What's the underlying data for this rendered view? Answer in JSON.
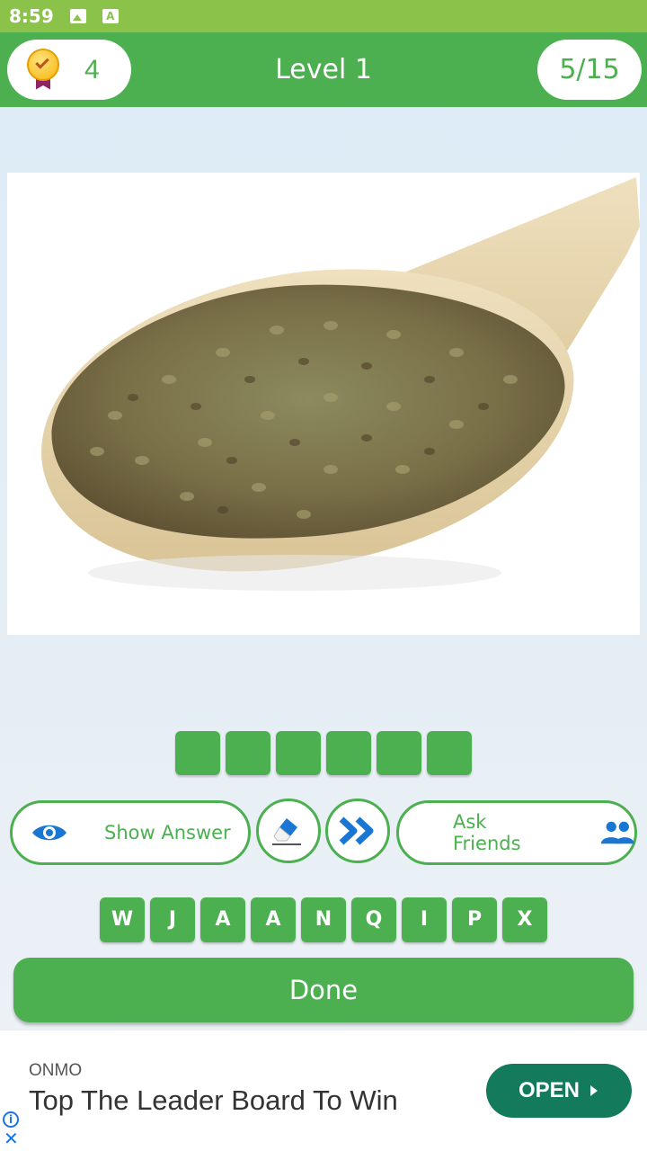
{
  "status_bar": {
    "time": "8:59",
    "icons": [
      "image-icon",
      "a-icon"
    ]
  },
  "header": {
    "coins": "4",
    "coin_icon": "medal-icon",
    "title": "Level 1",
    "progress": "5/15"
  },
  "puzzle": {
    "answer_length": 6,
    "slots": [
      "",
      "",
      "",
      "",
      "",
      ""
    ]
  },
  "help_buttons": {
    "show_answer_label": "Show Answer",
    "show_answer_icon": "eye-icon",
    "eraser_icon": "eraser-icon",
    "skip_icon": "double-chevron-icon",
    "ask_friends_label": "Ask Friends",
    "ask_friends_icon": "people-icon"
  },
  "letters": [
    "W",
    "J",
    "A",
    "A",
    "N",
    "Q",
    "I",
    "P",
    "X"
  ],
  "done_label": "Done",
  "ad": {
    "brand": "ONMO",
    "headline": "Top The Leader Board To Win",
    "cta": "OPEN"
  },
  "colors": {
    "primary_green": "#4caf50",
    "status_green": "#8bc34a",
    "ad_button": "#147a5c",
    "icon_blue": "#1976d2"
  }
}
